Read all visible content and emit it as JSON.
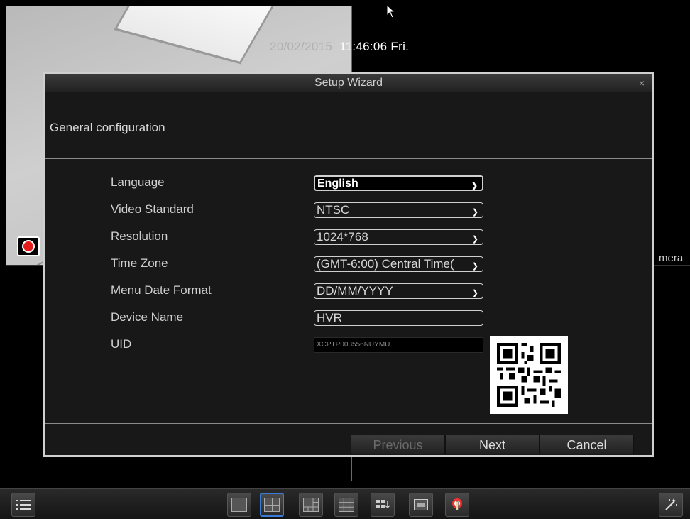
{
  "overlay": {
    "date": "20/02/2015",
    "time": "11:46:06 Fri.",
    "camera_label_partial": "mera"
  },
  "dialog": {
    "title": "Setup Wizard",
    "close": "×",
    "section_title": "General configuration",
    "fields": [
      {
        "label": "Language",
        "value": "English"
      },
      {
        "label": "Video Standard",
        "value": "NTSC"
      },
      {
        "label": "Resolution",
        "value": "1024*768"
      },
      {
        "label": "Time Zone",
        "value": "(GMT-6:00) Central Time("
      },
      {
        "label": "Menu Date Format",
        "value": "DD/MM/YYYY"
      },
      {
        "label": "Device Name",
        "value": "HVR"
      },
      {
        "label": "UID",
        "value": "XCPTP003556NUYMU"
      }
    ],
    "buttons": {
      "previous": "Previous",
      "next": "Next",
      "cancel": "Cancel"
    }
  },
  "colors": {
    "record": "#e21b1b",
    "active_tab": "#3a7bd5"
  },
  "taskbar": {
    "icons": [
      "menu-icon",
      "single-view-icon",
      "quad-view-icon",
      "six-view-icon",
      "nine-view-icon",
      "sequence-icon",
      "pip-icon",
      "ptz-icon",
      "wizard-icon"
    ]
  }
}
